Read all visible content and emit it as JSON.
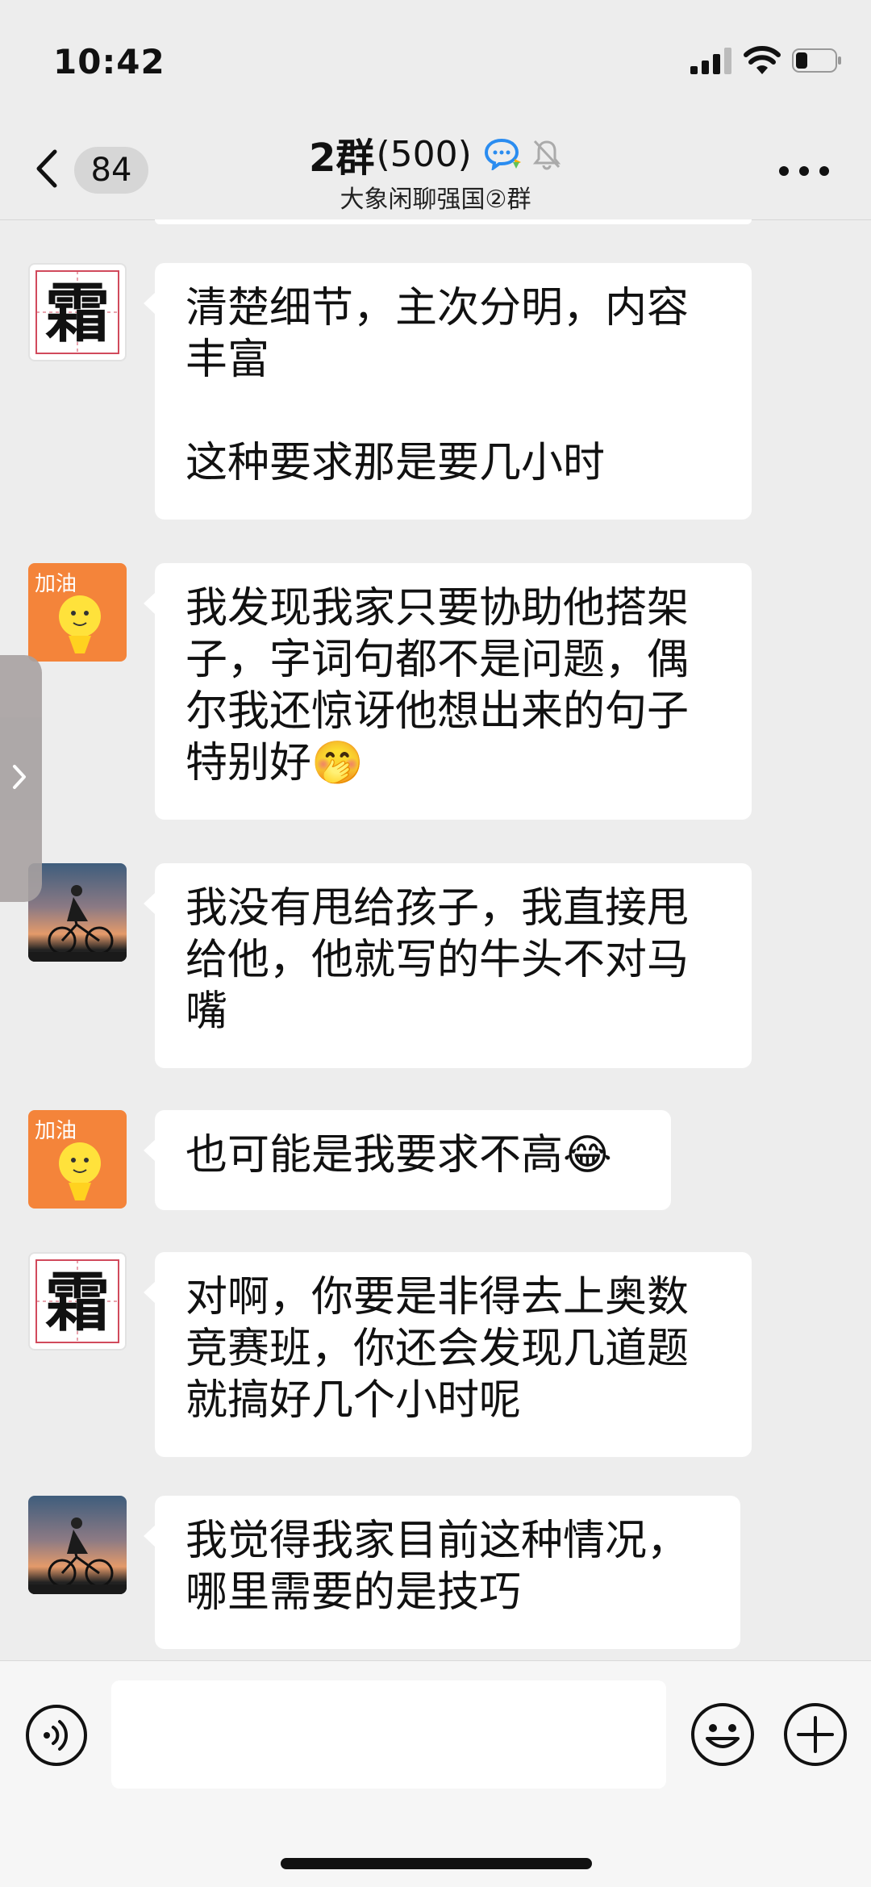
{
  "status_bar": {
    "time": "10:42",
    "icons": [
      "signal-icon",
      "wifi-icon",
      "battery-icon"
    ]
  },
  "nav": {
    "unread_count": "84",
    "title": "2群",
    "member_count": "(500)",
    "subtitle": "大象闲聊强国②群",
    "icons": [
      "back-chevron-icon",
      "chat-bubble-icon",
      "mute-bell-icon",
      "more-dots-icon"
    ]
  },
  "messages": [
    {
      "avatar": "shuang",
      "avatar_char": "霜",
      "text": "清楚细节，主次分明，内容\n丰富\n\n这种要求那是要几小时"
    },
    {
      "avatar": "jiayou",
      "avatar_char": "加油",
      "text": "我发现我家只要协助他搭架\n子，字词句都不是问题，偶\n尔我还惊讶他想出来的句子\n特别好🤭"
    },
    {
      "avatar": "bike",
      "text": "我没有甩给孩子，我直接甩\n给他，他就写的牛头不对马\n嘴"
    },
    {
      "avatar": "jiayou",
      "avatar_char": "加油",
      "text": "也可能是我要求不高😂"
    },
    {
      "avatar": "shuang",
      "avatar_char": "霜",
      "text": "对啊，你要是非得去上奥数\n竞赛班，你还会发现几道题\n就搞好几个小时呢"
    },
    {
      "avatar": "bike",
      "text": "我觉得我家目前这种情况，\n哪里需要的是技巧"
    }
  ],
  "input_bar": {
    "input_value": "",
    "icons": [
      "voice-icon",
      "emoji-icon",
      "plus-icon"
    ]
  },
  "colors": {
    "background": "#ededed",
    "bubble": "#ffffff",
    "jiayou_avatar": "#f4843a",
    "accent_blue": "#2a8cf0"
  }
}
